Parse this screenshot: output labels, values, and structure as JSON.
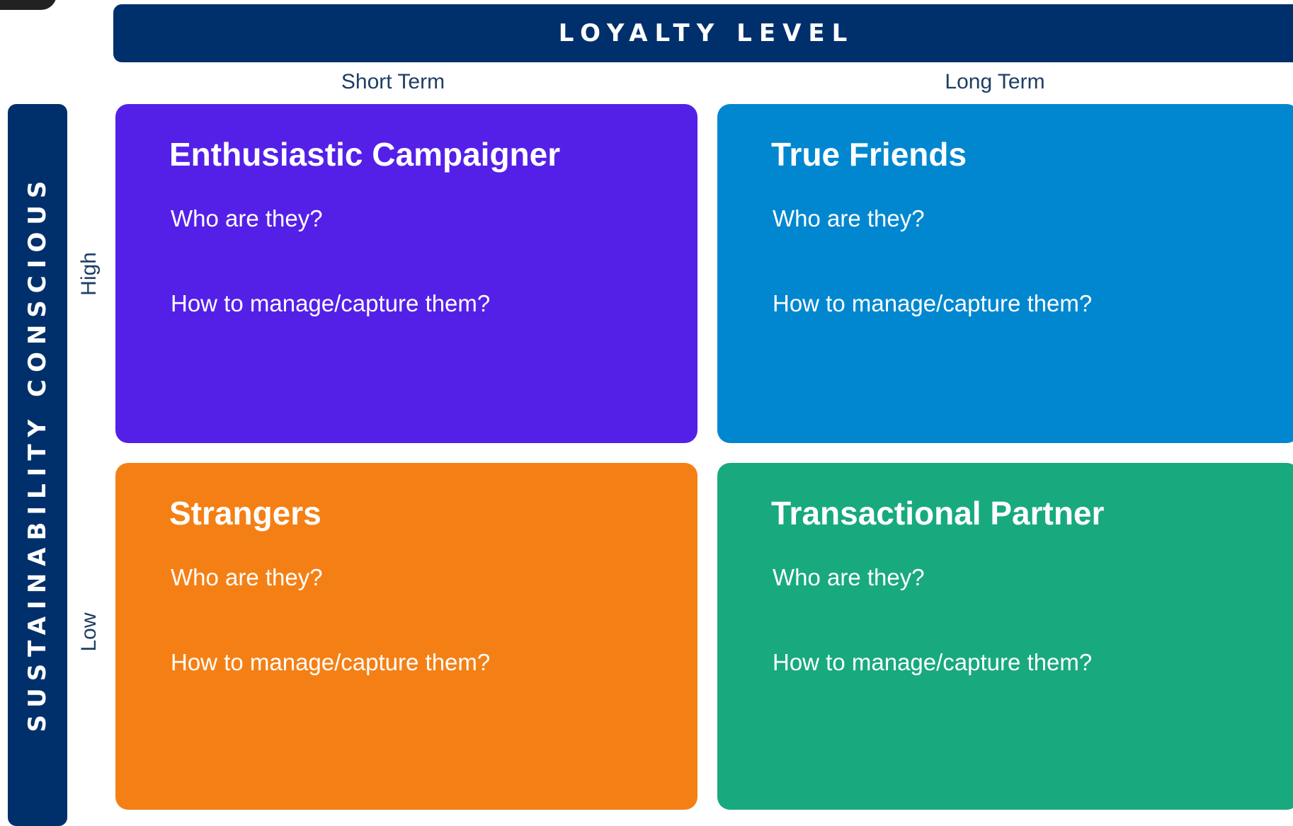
{
  "header": {
    "title": "LOYALTY LEVEL"
  },
  "columns": {
    "short": "Short Term",
    "long": "Long Term"
  },
  "side": {
    "title": "SUSTAINABILITY CONSCIOUS"
  },
  "rows": {
    "high": "High",
    "low": "Low"
  },
  "quadrants": [
    {
      "title": "Enthusiastic Campaigner",
      "question1": "Who are they?",
      "question2": "How to manage/capture them?",
      "color": "#5420e8"
    },
    {
      "title": "True Friends",
      "question1": "Who are they?",
      "question2": "How to manage/capture them?",
      "color": "#0187cf"
    },
    {
      "title": "Strangers",
      "question1": "Who are they?",
      "question2": "How to manage/capture them?",
      "color": "#f48015"
    },
    {
      "title": "Transactional Partner",
      "question1": "Who are they?",
      "question2": "How to manage/capture them?",
      "color": "#18a97f"
    }
  ],
  "colors": {
    "navy": "#00306b",
    "label_text": "#1f3d64"
  }
}
